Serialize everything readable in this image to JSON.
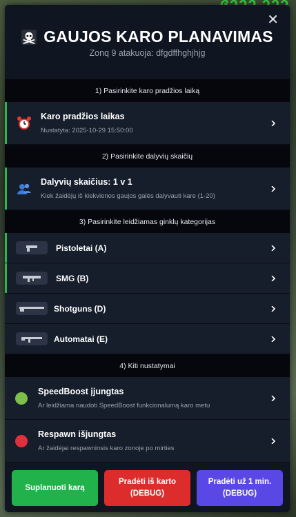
{
  "background": {
    "hud_text": "ɞɔɔɔ,ɔɔɔ"
  },
  "header": {
    "title": "GAUJOS KARO PLANAVIMAS",
    "subtitle": "Zonq 9 atakuoja: dfgdffhghjhjg",
    "close_symbol": "✕"
  },
  "sections": {
    "s1": "1) Pasirinkite karo pradžios laiką",
    "s2": "2) Pasirinkite dalyvių skaičių",
    "s3": "3) Pasirinkite leidžiamas ginklų kategorijas",
    "s4": "4) Kiti nustatymai"
  },
  "start_time": {
    "label": "Karo pradžios laikas",
    "value": "Nustatyta: 2025-10-29 15:50:00",
    "icon": "alarm-clock-icon"
  },
  "participants": {
    "label": "Dalyvių skaičius: 1 v 1",
    "description": "Kiek žaidėjų iš kiekvienos gaujos galės dalyvauti kare (1-20)",
    "icon": "users-icon"
  },
  "weapons": [
    {
      "label": "Pistoletai (A)",
      "enabled": true,
      "icon": "pistol-icon"
    },
    {
      "label": "SMG (B)",
      "enabled": true,
      "icon": "smg-icon"
    },
    {
      "label": "Shotguns (D)",
      "enabled": false,
      "icon": "shotgun-icon"
    },
    {
      "label": "Automatai (E)",
      "enabled": false,
      "icon": "rifle-icon"
    }
  ],
  "settings": {
    "speedboost": {
      "label": "SpeedBoost įjungtas",
      "description": "Ar leidžiama naudoti SpeedBoost funkcionalumą karo metu",
      "status_color": "#7cc04a"
    },
    "respawn": {
      "label": "Respawn išjungtas",
      "description": "Ar žaidėjai respawninsis karo zonoje po mirties",
      "status_color": "#e0303c"
    }
  },
  "buttons": {
    "plan": {
      "label": "Suplanuoti karą",
      "color": "#22b24c"
    },
    "start_now": {
      "line1": "Pradėti iš karto",
      "line2": "(DEBUG)",
      "color": "#dd2c2c"
    },
    "start_1min": {
      "line1": "Pradėti už 1 min.",
      "line2": "(DEBUG)",
      "color": "#5a48e6"
    }
  },
  "colors": {
    "panel": "#0f1521",
    "row": "#161d2b",
    "accent": "#2fb54e"
  }
}
